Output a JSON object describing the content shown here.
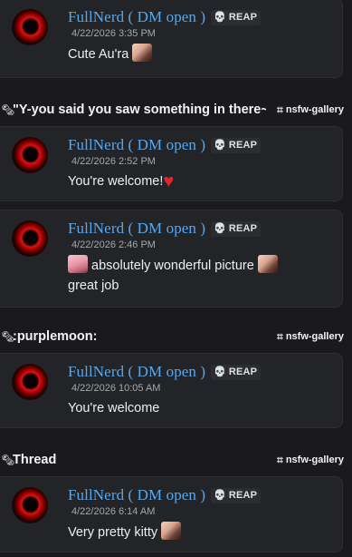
{
  "author": {
    "username": "FullNerd ( DM open )",
    "tag_icon": "skull-icon",
    "tag_label": "REAP"
  },
  "icons": {
    "thread": "🗞",
    "channel_hash": "⌗",
    "skull": "💀",
    "heart": "♥"
  },
  "messages": [
    {
      "timestamp": "4/22/2026 3:35 PM",
      "text": "Cute Au'ra"
    },
    {
      "timestamp": "4/22/2026 2:52 PM",
      "text": "You're welcome!"
    },
    {
      "timestamp": "4/22/2026 2:46 PM",
      "text_line1": "absolutely wonderful picture",
      "text_line2": "great job"
    },
    {
      "timestamp": "4/22/2026 10:05 AM",
      "text": "You're welcome"
    },
    {
      "timestamp": "4/22/2026 6:14 AM",
      "text": "Very pretty kitty"
    }
  ],
  "threads": [
    {
      "title": "\"Y-you said you saw something in there~",
      "channel": "nsfw-gallery"
    },
    {
      "title": ":purplemoon:",
      "channel": "nsfw-gallery"
    },
    {
      "title": "Thread",
      "channel": "nsfw-gallery"
    }
  ]
}
